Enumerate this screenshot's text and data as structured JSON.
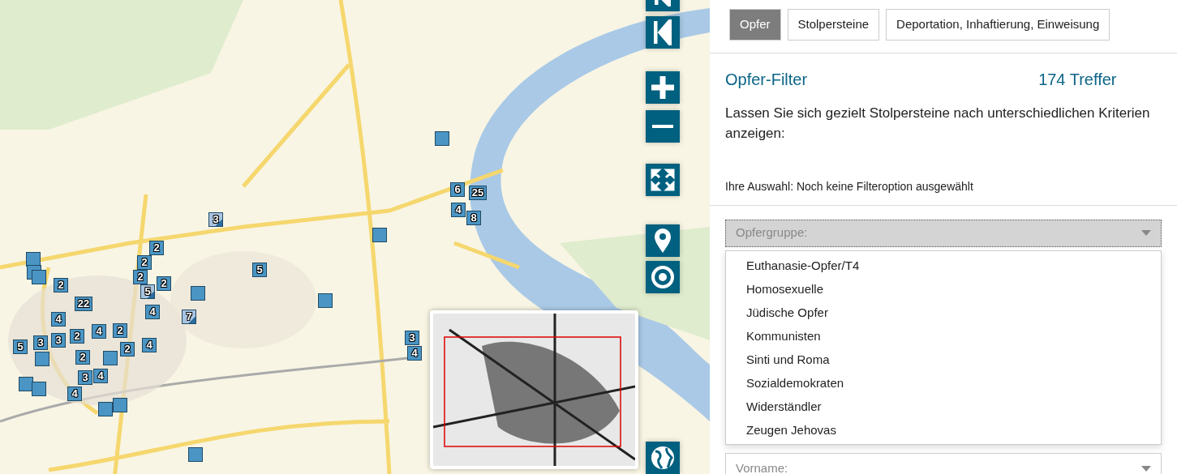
{
  "map": {
    "markers": [
      {
        "label": "3",
        "kind": "mixed"
      },
      {
        "label": "2",
        "kind": "plain"
      },
      {
        "label": "2",
        "kind": "plain"
      },
      {
        "label": "2",
        "kind": "plain"
      },
      {
        "label": "2",
        "kind": "plain"
      },
      {
        "label": "5",
        "kind": "mixed"
      },
      {
        "label": "5",
        "kind": "plain"
      },
      {
        "label": "2",
        "kind": "plain"
      },
      {
        "label": "22",
        "kind": "plain"
      },
      {
        "label": "4",
        "kind": "plain"
      },
      {
        "label": "4",
        "kind": "plain"
      },
      {
        "label": "7",
        "kind": "mixed"
      },
      {
        "label": "5",
        "kind": "plain"
      },
      {
        "label": "3",
        "kind": "plain"
      },
      {
        "label": "3",
        "kind": "plain"
      },
      {
        "label": "2",
        "kind": "plain"
      },
      {
        "label": "4",
        "kind": "plain"
      },
      {
        "label": "2",
        "kind": "plain"
      },
      {
        "label": "2",
        "kind": "plain"
      },
      {
        "label": "4",
        "kind": "plain"
      },
      {
        "label": "2",
        "kind": "plain"
      },
      {
        "label": "3",
        "kind": "plain"
      },
      {
        "label": "4",
        "kind": "plain"
      },
      {
        "label": "4",
        "kind": "plain"
      },
      {
        "label": "6",
        "kind": "plain"
      },
      {
        "label": "25",
        "kind": "plain"
      },
      {
        "label": "4",
        "kind": "plain"
      },
      {
        "label": "8",
        "kind": "plain"
      },
      {
        "label": "3",
        "kind": "plain"
      },
      {
        "label": "4",
        "kind": "plain"
      }
    ]
  },
  "tabs": [
    {
      "label": "Opfer",
      "selected": true
    },
    {
      "label": "Stolpersteine",
      "selected": false
    },
    {
      "label": "Deportation, Inhaftierung, Einweisung",
      "selected": false
    }
  ],
  "filter": {
    "title": "Opfer-Filter",
    "count": "174 Treffer",
    "intro": "Lassen Sie sich gezielt Stolpersteine nach unterschiedlichen Kriterien anzeigen:",
    "selection": "Ihre Auswahl: Noch keine Filteroption ausgewählt"
  },
  "victim_group_select": {
    "placeholder": "Opfergruppe:",
    "expanded": true,
    "options": [
      {
        "label": "Euthanasie-Opfer/T4",
        "selected": false
      },
      {
        "label": "Homosexuelle",
        "selected": false
      },
      {
        "label": "Jüdische Opfer",
        "selected": false
      },
      {
        "label": "Kommunisten",
        "selected": false
      },
      {
        "label": "Sinti und Roma",
        "selected": false
      },
      {
        "label": "Sozialdemokraten",
        "selected": false
      },
      {
        "label": "Widerständler",
        "selected": false
      },
      {
        "label": "Zeugen Jehovas",
        "selected": false
      }
    ]
  },
  "first_name_select": {
    "placeholder": "Vorname:"
  }
}
